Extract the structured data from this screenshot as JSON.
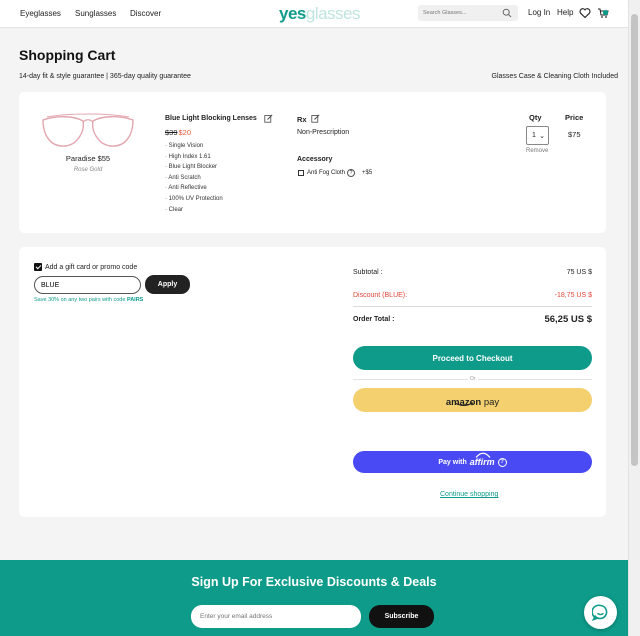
{
  "header": {
    "nav": [
      "Eyeglasses",
      "Sunglasses",
      "Discover"
    ],
    "logo_yes": "yes",
    "logo_glasses": "glasses",
    "search_placeholder": "Search Glasses...",
    "login": "Log In",
    "help": "Help"
  },
  "page": {
    "title": "Shopping Cart",
    "guarantee": "14-day fit & style guarantee | 365-day quality guarantee",
    "included": "Glasses Case & Cleaning Cloth Included"
  },
  "item": {
    "frame_name": "Paradise $55",
    "frame_color": "Rose Gold",
    "lens_title": "Blue Light Blocking Lenses",
    "lens_old_price": "$39",
    "lens_new_price": "$20",
    "features": [
      "· Single Vision",
      "· High Index 1.61",
      "· Blue Light Blocker",
      "· Anti Scratch",
      "· Anti Reflective",
      "· 100% UV Protection",
      "· Clear"
    ],
    "rx_label": "Rx",
    "rx_value": "Non-Prescription",
    "accessory_label": "Accessory",
    "accessory_name": "Anti Fog Cloth",
    "accessory_price": "+$5",
    "qty_label": "Qty",
    "qty_value": "1",
    "remove": "Remove",
    "price_label": "Price",
    "price_value": "$75"
  },
  "summary": {
    "gift_label": "Add a gift card or promo code",
    "promo_value": "BLUE",
    "apply": "Apply",
    "promo_hint_text": "Save 30% on any two pairs with code ",
    "promo_hint_code": "PAIRS",
    "subtotal_label": "Subtotal :",
    "subtotal_value": "75 US $",
    "discount_label": "Discount (BLUE):",
    "discount_value": "-18,75 US $",
    "total_label": "Order Total :",
    "total_value": "56,25 US $",
    "checkout": "Proceed to Checkout",
    "or": "Or",
    "amazon_word": "amazon",
    "amazon_pay": "pay",
    "affirm_prefix": "Pay with",
    "affirm_word": "affirm",
    "continue": "Continue shopping"
  },
  "footer": {
    "title": "Sign Up For Exclusive Discounts & Deals",
    "email_placeholder": "Enter your email address",
    "subscribe": "Subscribe"
  },
  "colors": {
    "brand": "#0e9b8a",
    "discount": "#e0473a",
    "amazon": "#f4d06f",
    "affirm": "#4a4af4"
  },
  "icons": [
    "search-icon",
    "heart-icon",
    "cart-icon",
    "edit-icon",
    "info-icon",
    "chevron-down-icon",
    "chat-icon"
  ]
}
